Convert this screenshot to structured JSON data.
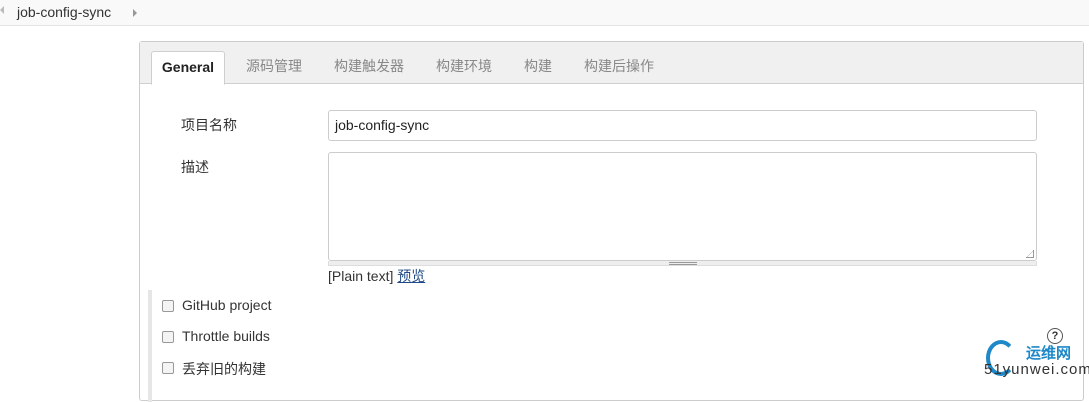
{
  "breadcrumb": {
    "item": "job-config-sync"
  },
  "tabs": [
    {
      "label": "General"
    },
    {
      "label": "源码管理"
    },
    {
      "label": "构建触发器"
    },
    {
      "label": "构建环境"
    },
    {
      "label": "构建"
    },
    {
      "label": "构建后操作"
    }
  ],
  "form": {
    "name_label": "项目名称",
    "name_value": "job-config-sync",
    "desc_label": "描述",
    "desc_value": "",
    "plain_text": "[Plain text]",
    "preview_link": "预览"
  },
  "options": [
    {
      "label": "GitHub project",
      "checked": false
    },
    {
      "label": "Throttle builds",
      "checked": false
    },
    {
      "label": "丢弃旧的构建",
      "checked": false
    }
  ],
  "help_icon": "?",
  "watermark": {
    "top": "运维网",
    "bottom": "51yunwei.com"
  }
}
